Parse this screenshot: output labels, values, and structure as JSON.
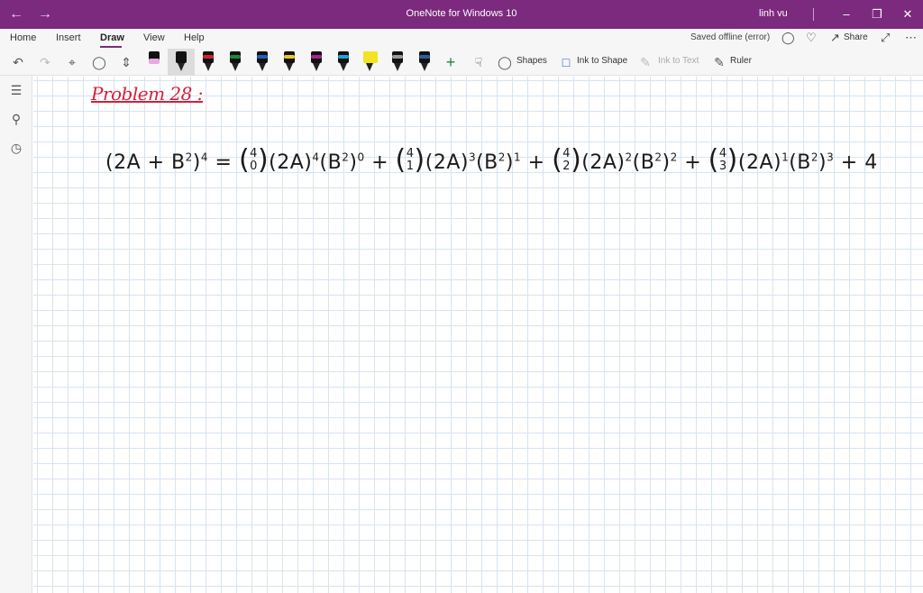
{
  "titlebar": {
    "back_icon": "back-arrow-icon",
    "forward_icon": "forward-arrow-icon",
    "title": "OneNote for Windows 10",
    "user": "linh vu",
    "window_controls": [
      "minimize",
      "restore",
      "close"
    ]
  },
  "menu": {
    "items": [
      "Home",
      "Insert",
      "Draw",
      "View",
      "Help"
    ],
    "active": "Draw",
    "saved_status": "Saved offline (error)",
    "share_label": "Share"
  },
  "toolbar": {
    "shapes_label": "Shapes",
    "ink_to_shape_label": "Ink to Shape",
    "ink_to_text_label": "Ink to Text",
    "ruler_label": "Ruler",
    "pens": [
      {
        "name": "pink-highlighter",
        "color": "#e7a8e6"
      },
      {
        "name": "black-pen",
        "color": "#111111"
      },
      {
        "name": "red-pen",
        "color": "#d62030"
      },
      {
        "name": "green-pen",
        "color": "#1b8a3a"
      },
      {
        "name": "blue-pen",
        "color": "#1f5fbf"
      },
      {
        "name": "yellow-pen",
        "color": "#f2c81b"
      },
      {
        "name": "magenta-pen",
        "color": "#b0208f"
      },
      {
        "name": "cyan-pen",
        "color": "#17a6d6"
      },
      {
        "name": "yellow-highlighter",
        "color": "#f3e321"
      },
      {
        "name": "gray-pen",
        "color": "#9a9a9a"
      },
      {
        "name": "navy-pen",
        "color": "#2a5fa0"
      }
    ]
  },
  "note": {
    "problem_title": "Problem 28 :",
    "equation": {
      "lhs_base": "(2A + B",
      "lhs_sq": "2",
      "lhs_close": ")",
      "lhs_exp": "4",
      "equals": " = ",
      "t0_top": "4",
      "t0_bot": "0",
      "t0_rest": "(2A)",
      "t0_e1": "4",
      "t0_b": "(B",
      "t0_bs": "2",
      "t0_bc": ")",
      "t0_e2": "0",
      "plus": " + ",
      "t1_top": "4",
      "t1_bot": "1",
      "t1_rest": "(2A)",
      "t1_e1": "3",
      "t1_b": "(B",
      "t1_bs": "2",
      "t1_bc": ")",
      "t1_e2": "1",
      "t2_top": "4",
      "t2_bot": "2",
      "t2_rest": "(2A)",
      "t2_e1": "2",
      "t2_b": "(B",
      "t2_bs": "2",
      "t2_bc": ")",
      "t2_e2": "2",
      "t3_top": "4",
      "t3_bot": "3",
      "t3_rest": "(2A)",
      "t3_e1": "1",
      "t3_b": "(B",
      "t3_bs": "2",
      "t3_bc": ")",
      "t3_e2": "3",
      "tail": " + 4"
    }
  },
  "sidebar": {
    "icons": [
      "notebooks-icon",
      "search-icon",
      "recent-icon"
    ]
  }
}
